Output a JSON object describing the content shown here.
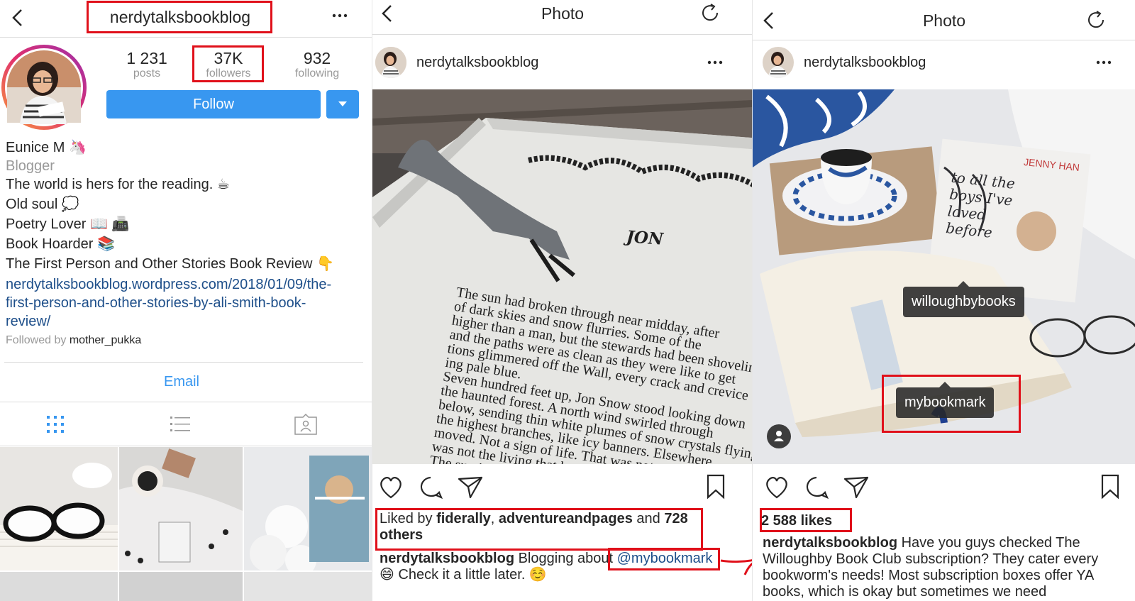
{
  "profile": {
    "username": "nerdytalksbookblog",
    "stats": [
      {
        "value": "1 231",
        "label": "posts"
      },
      {
        "value": "37K",
        "label": "followers"
      },
      {
        "value": "932",
        "label": "following"
      }
    ],
    "follow_label": "Follow",
    "name": "Eunice M",
    "name_emoji": "🦄",
    "category": "Blogger",
    "bio_lines": [
      "The world is hers for the reading. ☕",
      "Old soul 💭",
      "Poetry Lover 📖 📠",
      "Book Hoarder 📚",
      "The First Person and Other Stories Book Review 👇"
    ],
    "link_lines": [
      "nerdytalksbookblog.wordpress.com/2018/01/09/the-",
      "first-person-and-other-stories-by-ali-smith-book-",
      "review/"
    ],
    "followed_by_prefix": "Followed by",
    "followed_by_user": "mother_pukka",
    "email_label": "Email"
  },
  "post1": {
    "header_title": "Photo",
    "username": "nerdytalksbookblog",
    "image_text": {
      "chapter": "JON",
      "lines": [
        "The sun had broken through near midday, after",
        "of dark skies and snow flurries. Some of the",
        "higher than a man, but the stewards had been shoveling",
        "and the paths were as clean as they were like to get",
        "tions glimmered off the Wall, every crack and crevice",
        "ing pale blue.",
        "Seven hundred feet up, Jon Snow stood looking down",
        "the haunted forest. A north wind swirled through",
        "below, sending thin white plumes of snow crystals flying",
        "the highest branches, like icy banners. Elsewhere",
        "moved. Not a sign of life. That was not",
        "was not the living that he feared.",
        "The sun is ..."
      ]
    },
    "liked_prefix": "Liked by",
    "liked_user1": "fiderally",
    "liked_sep": ",",
    "liked_user2": "adventureandpages",
    "liked_and": "and",
    "liked_count": "728",
    "liked_others": "others",
    "caption_user": "nerdytalksbookblog",
    "caption_text": "Blogging about",
    "caption_mention": "@mybookmark",
    "caption_line2": "😄 Check it a little later. ☺️"
  },
  "post2": {
    "header_title": "Photo",
    "username": "nerdytalksbookblog",
    "tag1": "willoughbybooks",
    "tag2": "mybookmark",
    "likes": "2 588 likes",
    "caption_user": "nerdytalksbookblog",
    "caption_text1": "Have you guys checked The",
    "caption_lines": [
      "Willoughby Book Club subscription? They cater every",
      "bookworm's needs! Most subscription boxes offer YA",
      "books, which is okay but sometimes we need"
    ]
  },
  "colors": {
    "accent": "#3897f0",
    "highlight": "#e0101a",
    "text": "#262626",
    "muted": "#999999"
  }
}
